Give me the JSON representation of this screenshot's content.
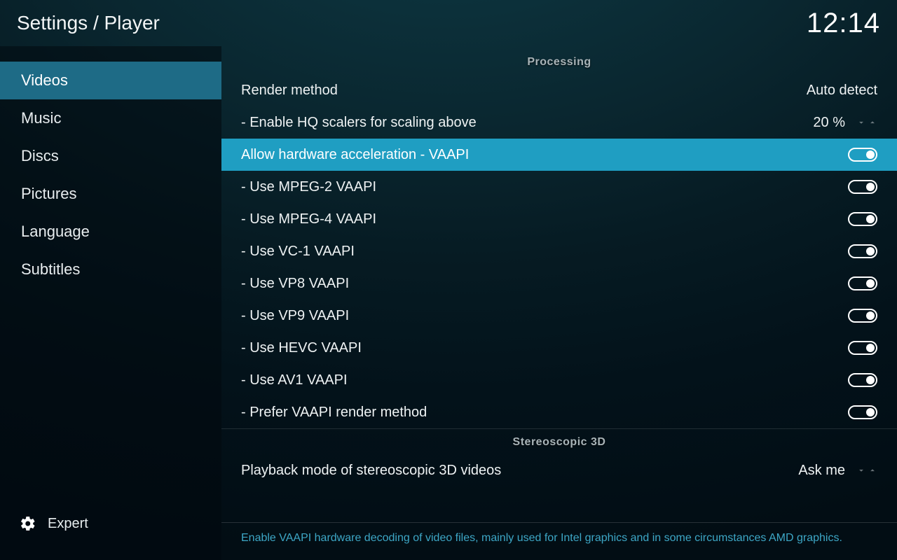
{
  "header": {
    "title": "Settings / Player",
    "clock": "12:14"
  },
  "sidebar": {
    "items": [
      {
        "label": "Videos",
        "active": true
      },
      {
        "label": "Music",
        "active": false
      },
      {
        "label": "Discs",
        "active": false
      },
      {
        "label": "Pictures",
        "active": false
      },
      {
        "label": "Language",
        "active": false
      },
      {
        "label": "Subtitles",
        "active": false
      }
    ],
    "level_label": "Expert"
  },
  "sections": [
    {
      "title": "Processing",
      "rows": [
        {
          "kind": "select",
          "label": "Render method",
          "value": "Auto detect",
          "selected": false
        },
        {
          "kind": "spinner",
          "label": "- Enable HQ scalers for scaling above",
          "value": "20 %",
          "selected": false
        },
        {
          "kind": "toggle",
          "label": "Allow hardware acceleration - VAAPI",
          "on": true,
          "selected": true
        },
        {
          "kind": "toggle",
          "label": "- Use MPEG-2 VAAPI",
          "on": true,
          "selected": false
        },
        {
          "kind": "toggle",
          "label": "- Use MPEG-4 VAAPI",
          "on": true,
          "selected": false
        },
        {
          "kind": "toggle",
          "label": "- Use VC-1 VAAPI",
          "on": true,
          "selected": false
        },
        {
          "kind": "toggle",
          "label": "- Use VP8 VAAPI",
          "on": true,
          "selected": false
        },
        {
          "kind": "toggle",
          "label": "- Use VP9 VAAPI",
          "on": true,
          "selected": false
        },
        {
          "kind": "toggle",
          "label": "- Use HEVC VAAPI",
          "on": true,
          "selected": false
        },
        {
          "kind": "toggle",
          "label": "- Use AV1 VAAPI",
          "on": true,
          "selected": false
        },
        {
          "kind": "toggle",
          "label": "- Prefer VAAPI render method",
          "on": true,
          "selected": false
        }
      ]
    },
    {
      "title": "Stereoscopic 3D",
      "rows": [
        {
          "kind": "spinner",
          "label": "Playback mode of stereoscopic 3D videos",
          "value": "Ask me",
          "selected": false
        }
      ]
    }
  ],
  "description": "Enable VAAPI hardware decoding of video files, mainly used for Intel graphics and in some circumstances AMD graphics."
}
